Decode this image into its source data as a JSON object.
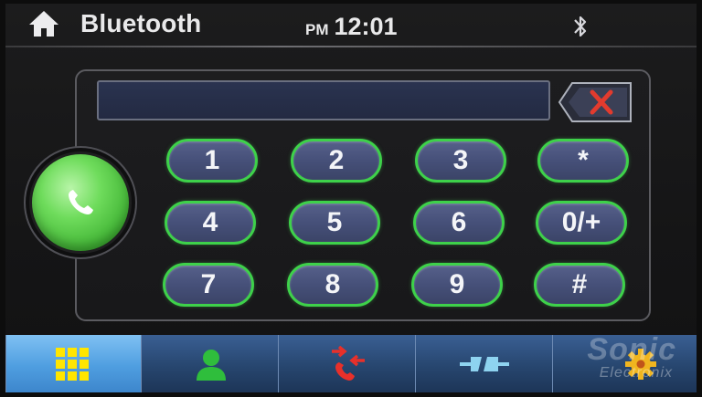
{
  "header": {
    "title": "Bluetooth",
    "ampm": "PM",
    "time": "12:01",
    "home_icon": "home-icon",
    "status_icon": "bluetooth-icon"
  },
  "dialer": {
    "number": "",
    "backspace_icon": "backspace-x-icon",
    "call_icon": "phone-handset-icon",
    "keys": [
      "1",
      "2",
      "3",
      "*",
      "4",
      "5",
      "6",
      "0/+",
      "7",
      "8",
      "9",
      "#"
    ]
  },
  "nav": {
    "tabs": [
      {
        "icon": "dialpad-grid-icon",
        "active": true
      },
      {
        "icon": "contact-person-icon",
        "active": false
      },
      {
        "icon": "call-history-icon",
        "active": false
      },
      {
        "icon": "link-connection-icon",
        "active": false
      },
      {
        "icon": "settings-gear-icon",
        "active": false
      }
    ]
  },
  "watermark": {
    "brand": "Sonic",
    "sub": "Electronix"
  },
  "colors": {
    "key_border": "#3ed14a",
    "key_fill": "#465079",
    "call_green": "#6fdc5c",
    "nav_active": "#4f9ee0",
    "nav_inactive": "#27466f",
    "backspace_x": "#e23b2e"
  }
}
